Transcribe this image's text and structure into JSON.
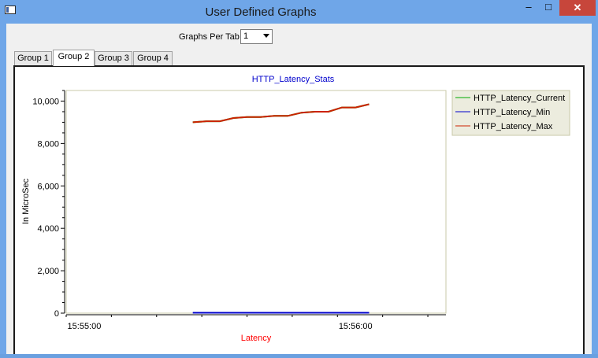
{
  "window": {
    "title": "User Defined Graphs"
  },
  "controls": {
    "minimize": "–",
    "maximize": "□",
    "close": "✕"
  },
  "toolbar": {
    "graphs_per_tab_label": "Graphs Per Tab",
    "graphs_per_tab_value": "1"
  },
  "tabs": [
    {
      "label": "Group 1",
      "active": false
    },
    {
      "label": "Group 2",
      "active": true
    },
    {
      "label": "Group 3",
      "active": false
    },
    {
      "label": "Group 4",
      "active": false
    }
  ],
  "colors": {
    "title": "#0000cc",
    "xlabel": "#ff0000",
    "current": "#00aa00",
    "min": "#0000cc",
    "max": "#cc2200"
  },
  "chart_data": {
    "type": "line",
    "title": "HTTP_Latency_Stats",
    "xlabel": "Latency",
    "ylabel": "In MicroSec",
    "ylim": [
      0,
      10500
    ],
    "yticks": [
      0,
      2000,
      4000,
      6000,
      8000,
      10000
    ],
    "ytick_labels": [
      "0",
      "2,000",
      "4,000",
      "6,000",
      "8,000",
      "10,000"
    ],
    "xlim": [
      "15:54:56",
      "15:56:20"
    ],
    "xticks": [
      "15:55:00",
      "15:56:00"
    ],
    "legend_position": "right",
    "grid": false,
    "x": [
      "15:55:24",
      "15:55:27",
      "15:55:30",
      "15:55:33",
      "15:55:36",
      "15:55:39",
      "15:55:42",
      "15:55:45",
      "15:55:48",
      "15:55:51",
      "15:55:54",
      "15:55:57",
      "15:56:00",
      "15:56:03"
    ],
    "series": [
      {
        "name": "HTTP_Latency_Current",
        "color": "#00aa00",
        "values": [
          9000,
          9050,
          9050,
          9200,
          9250,
          9250,
          9300,
          9300,
          9450,
          9500,
          9500,
          9700,
          9700,
          9850
        ]
      },
      {
        "name": "HTTP_Latency_Min",
        "color": "#0000cc",
        "values": [
          20,
          20,
          20,
          20,
          20,
          20,
          20,
          20,
          20,
          20,
          20,
          20,
          20,
          20
        ]
      },
      {
        "name": "HTTP_Latency_Max",
        "color": "#cc2200",
        "values": [
          9000,
          9050,
          9050,
          9200,
          9250,
          9250,
          9300,
          9300,
          9450,
          9500,
          9500,
          9700,
          9700,
          9850
        ]
      }
    ]
  }
}
